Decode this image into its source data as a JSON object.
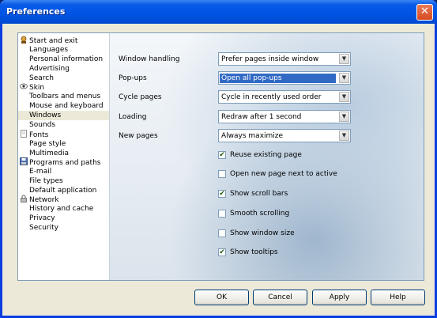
{
  "window": {
    "title": "Preferences",
    "close_glyph": "✕"
  },
  "tree": [
    {
      "label": "Start and exit",
      "type": "category",
      "icon": "start-exit-icon"
    },
    {
      "label": "Languages",
      "type": "sub"
    },
    {
      "label": "Personal information",
      "type": "sub"
    },
    {
      "label": "Advertising",
      "type": "sub"
    },
    {
      "label": "Search",
      "type": "sub"
    },
    {
      "label": "Skin",
      "type": "category",
      "icon": "eye-icon"
    },
    {
      "label": "Toolbars and menus",
      "type": "sub"
    },
    {
      "label": "Mouse and keyboard",
      "type": "sub"
    },
    {
      "label": "Windows",
      "type": "sub",
      "selected": true
    },
    {
      "label": "Sounds",
      "type": "sub"
    },
    {
      "label": "Fonts",
      "type": "category",
      "icon": "page-icon"
    },
    {
      "label": "Page style",
      "type": "sub"
    },
    {
      "label": "Multimedia",
      "type": "sub"
    },
    {
      "label": "Programs and paths",
      "type": "category",
      "icon": "floppy-icon"
    },
    {
      "label": "E-mail",
      "type": "sub"
    },
    {
      "label": "File types",
      "type": "sub"
    },
    {
      "label": "Default application",
      "type": "sub"
    },
    {
      "label": "Network",
      "type": "category",
      "icon": "lock-icon"
    },
    {
      "label": "History and cache",
      "type": "sub"
    },
    {
      "label": "Privacy",
      "type": "sub"
    },
    {
      "label": "Security",
      "type": "sub"
    }
  ],
  "settings": {
    "window_handling": {
      "label": "Window handling",
      "value": "Prefer pages inside window"
    },
    "popups": {
      "label": "Pop-ups",
      "value": "Open all pop-ups"
    },
    "cycle_pages": {
      "label": "Cycle pages",
      "value": "Cycle in recently used order"
    },
    "loading": {
      "label": "Loading",
      "value": "Redraw after 1 second"
    },
    "new_pages": {
      "label": "New pages",
      "value": "Always maximize"
    }
  },
  "checkboxes": [
    {
      "label": "Reuse existing page",
      "checked": true
    },
    {
      "label": "Open new page next to active",
      "checked": false
    },
    {
      "label": "Show scroll bars",
      "checked": true
    },
    {
      "label": "Smooth scrolling",
      "checked": false
    },
    {
      "label": "Show window size",
      "checked": false
    },
    {
      "label": "Show tooltips",
      "checked": true
    }
  ],
  "buttons": {
    "ok": "OK",
    "cancel": "Cancel",
    "apply": "Apply",
    "help": "Help"
  },
  "check_glyph": "✔",
  "dropdown_glyph": "▼",
  "colors": {
    "title_bar": "#0055e5",
    "selection": "#316ac5",
    "panel": "#ece9d8"
  }
}
